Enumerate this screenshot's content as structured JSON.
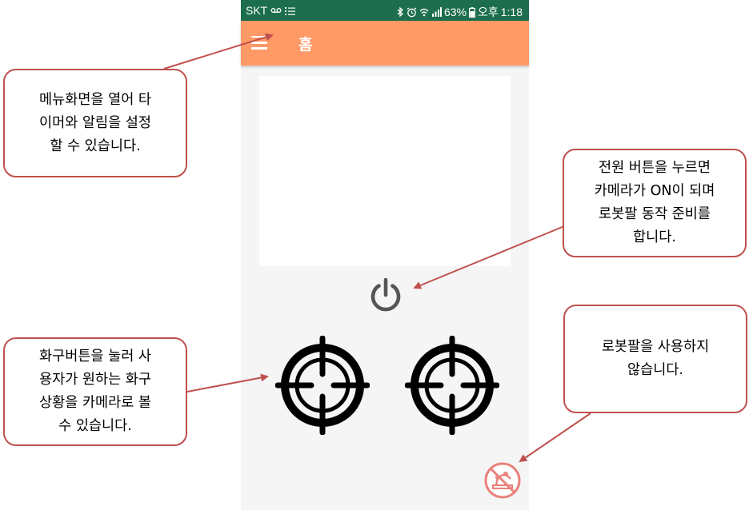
{
  "status_bar": {
    "carrier": "SKT",
    "battery": "63%",
    "am_pm": "오후",
    "time": "1:18"
  },
  "app_bar": {
    "menu_icon": "hamburger-menu-icon",
    "title": "홈"
  },
  "controls": {
    "power_icon": "power-icon",
    "burner_left_icon": "crosshair-target-icon",
    "burner_right_icon": "crosshair-target-icon",
    "robot_disable_icon": "robot-arm-off-icon"
  },
  "callouts": {
    "menu": "메뉴화면을 열어 타\n이머와 알림을 설정\n할 수 있습니다.",
    "power": "전원 버튼을 누르면\n카메라가 ON이 되며\n로봇팔 동작 준비를\n합니다.",
    "stove": "화구버튼을 눌러 사\n용자가 원하는 화구\n상황을 카메라로 볼\n수 있습니다.",
    "robot": "로봇팔을 사용하지\n않습니다."
  },
  "colors": {
    "status_bar": "#1d6e4f",
    "app_bar": "#ff9966",
    "callout_border": "#c0504d",
    "arrow": "#c0504d",
    "power_icon": "#555555",
    "robot_icon": "#e8827b"
  }
}
